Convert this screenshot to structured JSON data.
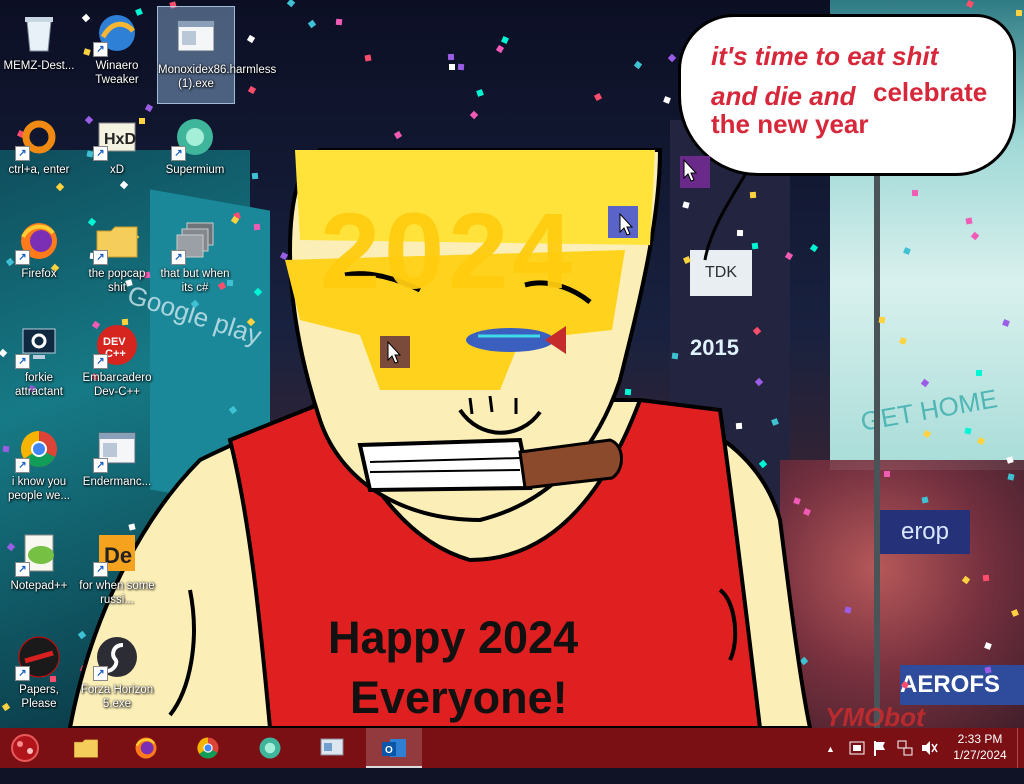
{
  "desktop_icons": [
    {
      "label": "MEMZ-Dest...",
      "icon": "recycle-bin-icon"
    },
    {
      "label": "Winaero Tweaker",
      "icon": "winaero-tweaker-icon"
    },
    {
      "label": "Monoxidex86.harmless (1).exe",
      "icon": "window-app-icon"
    },
    {
      "label": "ctrl+a, enter",
      "icon": "orange-ring-icon"
    },
    {
      "label": "xD",
      "icon": "hxd-icon"
    },
    {
      "label": "Supermium",
      "icon": "supermium-icon"
    },
    {
      "label": "Firefox",
      "icon": "firefox-icon"
    },
    {
      "label": "the popcap shit",
      "icon": "folder-icon"
    },
    {
      "label": "that but when its c#",
      "icon": "stacked-windows-icon"
    },
    {
      "label": "forkie attractant",
      "icon": "settings-monitor-icon"
    },
    {
      "label": "Embarcadero Dev-C++",
      "icon": "dev-cpp-icon"
    },
    {
      "label": "i know you people we...",
      "icon": "chrome-icon"
    },
    {
      "label": "Endermanc...",
      "icon": "window-app-icon"
    },
    {
      "label": "Notepad++",
      "icon": "notepad-plus-plus-icon"
    },
    {
      "label": "for when some russi...",
      "icon": "de-icon"
    },
    {
      "label": "Papers, Please",
      "icon": "papers-please-icon"
    },
    {
      "label": "Forza Horizon 5.exe",
      "icon": "flash-icon"
    }
  ],
  "wallpaper": {
    "bubble_lines": [
      "it's time to eat shit",
      "and die and",
      "celebrate",
      "the new year"
    ],
    "headband_text": "2024",
    "shirt_lines": [
      "Happy 2024",
      "Everyone!"
    ],
    "billboard_tdk": "TDK",
    "billboard_2015": "2015",
    "billboard_google_play": "Google play",
    "billboard_get_home": "GET HOME",
    "billboard_eroplane": "erop",
    "billboard_aeroflot": "AEROFS",
    "watermark": "YMObot"
  },
  "taskbar": {
    "apps": [
      {
        "name": "file-explorer",
        "icon": "folder-icon",
        "active": false
      },
      {
        "name": "firefox",
        "icon": "firefox-icon",
        "active": false
      },
      {
        "name": "chrome",
        "icon": "chrome-icon",
        "active": false
      },
      {
        "name": "supermium",
        "icon": "supermium-icon",
        "active": false
      },
      {
        "name": "control-panel",
        "icon": "control-panel-icon",
        "active": false
      },
      {
        "name": "outlook",
        "icon": "outlook-icon",
        "active": true
      }
    ],
    "clock_time": "2:33 PM",
    "clock_date": "1/27/2024",
    "tray_chevron": "▲"
  },
  "colors": {
    "taskbar": "#7a0f14",
    "bubble_text": "#d6283a",
    "shirt": "#e02020",
    "skin": "#fbeeb6",
    "headband": "#ffd21e"
  }
}
